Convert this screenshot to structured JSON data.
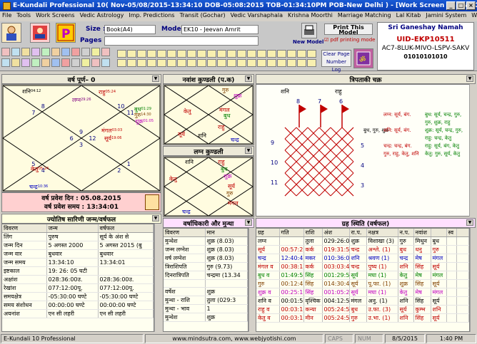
{
  "window": {
    "title": "E-Kundali Professional 10( Nov-05/08/2015-13:34:10 DOB-05:08:2015 TOB-01:34:10PM POB-New Delhi )  - [Work Screen Annual Chart]"
  },
  "menu": [
    "File",
    "Tools",
    "Work Screens",
    "Vedic Astrology",
    "Imp. Predictions",
    "Transit (Gochar)",
    "Vedic Varshaphala",
    "Krishna Moorthi",
    "Marriage Matching",
    "Lal Kitab",
    "Jamini System",
    "Window"
  ],
  "toolbar": {
    "size_label": "Size :",
    "size_value": "Book(A4)",
    "model_label": "Model :",
    "model_value": "EK10 - Jeevan Amrit",
    "pages_label": "Pages :",
    "new_model": "New Model",
    "print_model": "Print This Model",
    "pdf_printing": "pdf printing mode",
    "clear_page": "Clear Page",
    "number_log": "Number Log",
    "greeting": "Sri Ganeshay Namah",
    "uid": "UID-EKP10511",
    "code": "AC7-8LUK-MIVO-LSPV-SAKV",
    "serial": "01010101010"
  },
  "varsh": {
    "title": "वर्ष पूर्ण– 0",
    "pravesh_din": "वर्ष प्रवेश दिन : 05.08.2015",
    "pravesh_samay": "वर्ष प्रवेश समय : 13:34:01",
    "houses": [
      "9",
      "8",
      "7",
      "6",
      "5",
      "4",
      "3",
      "2",
      "1",
      "12",
      "11",
      "10"
    ],
    "planets": [
      {
        "t": "शनि",
        "d": "04:12",
        "c": "#000"
      },
      {
        "t": "राहु",
        "d": "05:24",
        "c": "#c00000"
      },
      {
        "t": "लग्न",
        "d": "29:26",
        "c": "#800080"
      },
      {
        "t": "बुध",
        "d": "01:29",
        "c": "#008000"
      },
      {
        "t": "गुरु",
        "d": "14:30",
        "c": "#804000"
      },
      {
        "t": "शुक्र",
        "d": "01:05",
        "c": "#c000c0"
      },
      {
        "t": "मंगल",
        "d": "03:03",
        "c": "#c00000"
      },
      {
        "t": "सूर्य",
        "d": "19:06",
        "c": "#c00000"
      },
      {
        "t": "केतु",
        "d": "05:24",
        "c": "#c00000"
      },
      {
        "t": "चन्द्र",
        "d": "10:36",
        "c": "#0000c0"
      }
    ]
  },
  "navamsha": {
    "title": "नवांश कुण्डली (प.क)",
    "planets": [
      "गुरु",
      "शुक्र",
      "केतु",
      "मंगल",
      "बुध",
      "राहु",
      "सूर्य",
      "शनि",
      "चन्द्र"
    ]
  },
  "lagna": {
    "title": "लग्न कुण्डली",
    "planets": [
      "शनि",
      "राहु",
      "बुध",
      "शुक्र",
      "केतु",
      "सूर्य",
      "गुरु",
      "मंगल",
      "चन्द्र"
    ]
  },
  "tripataki": {
    "title": "त्रिपताकी चक्र",
    "top": [
      "शनि",
      "राहु"
    ],
    "left": [
      "9",
      "10",
      "11"
    ],
    "right": [
      "3",
      "4",
      "5"
    ],
    "topnums": [
      "8",
      "7",
      "6"
    ],
    "mid": [
      "बुध, गुरु, शुक्र"
    ],
    "lines": [
      [
        "लग्न: सूर्य, बंग.",
        "बुध: सूर्य, चन्द्र, गुरु,"
      ],
      [
        "",
        "गुरु, शुक्र, राहु"
      ],
      [
        "शनि: सूर्य, बंग.",
        "शुक्र: सूर्य, चन्द्र, गुरु,"
      ],
      [
        "",
        "राहु: चन्द्र, केतु"
      ],
      [
        "चन्द्र: चन्द्र, बंग.",
        "राहु: सूर्य, बंग, केतु"
      ],
      [
        "गुरु, राहु, केतु, शनि",
        "केतु: गुरु, सूर्य, केतु"
      ]
    ]
  },
  "jyotish": {
    "title": "ज्योतिष सारिणी जन्म/वर्षफल",
    "cols": [
      "विवरण",
      "जन्म",
      "वर्षफल"
    ],
    "rows": [
      [
        "लिंग",
        "पुरुष",
        "सूर्य के अंश से"
      ],
      [
        "जन्म दिन",
        "5 अगस्त 2000",
        "5 अगस्त 2015 (बु"
      ],
      [
        "जन्म वार",
        "बुधवार",
        "बुधवार"
      ],
      [
        "जन्म समय",
        "13:34:10",
        "13:34:01"
      ],
      [
        "इष्टकाल",
        "19: 26: 05 घटी",
        ""
      ],
      [
        "अक्षांश",
        "028:36:00उ.",
        "028:36:00उ."
      ],
      [
        "रेखांश",
        "077:12:00पू.",
        "077:12:00पू."
      ],
      [
        "समयक्षेत्र",
        "-05:30:00 घण्टे",
        "-05:30:00 घण्टे"
      ],
      [
        "समय संशोधन",
        "00:00:00 घण्टे",
        "00:00:00 घण्टे"
      ],
      [
        "अयनांश",
        "एन सी लहरी",
        "एन सी लहरी"
      ]
    ]
  },
  "varshadhikari": {
    "title": "वर्षाधिकारी और मुन्था",
    "cols": [
      "विवरण",
      "मान"
    ],
    "rows": [
      [
        "मुन्थेश",
        "शुक्र (8.03)"
      ],
      [
        "जन्म लग्नेश",
        "शुक्र (8.03)"
      ],
      [
        "वर्ष लग्नेश",
        "शुक्र (8.03)"
      ],
      [
        "त्रिराशिपति",
        "गुरु (9.73)"
      ],
      [
        "दिनरात्रिपति",
        "चन्द्रमा (13.34"
      ],
      [
        "",
        ""
      ],
      [
        "वर्षेश",
        "शुक्र"
      ],
      [
        "मुन्था - राशि",
        "तुला  (029:3"
      ],
      [
        "मुन्था - भाव",
        "1"
      ],
      [
        "मुन्थेश",
        "शुक्र"
      ]
    ]
  },
  "grah": {
    "title": "ग्रह स्थिति (वर्षफल)",
    "cols": [
      "ग्रह",
      "गति",
      "राशि",
      "अंश",
      "रा.प.",
      "नक्षत्र",
      "न.प.",
      "नवांश",
      "",
      "स्व"
    ],
    "rows": [
      [
        "लग्न",
        "",
        "तुला",
        "029:26:06",
        "शुक्र",
        "विशाखा (3)",
        "गुरु",
        "मिथुन",
        "बुध",
        "",
        ""
      ],
      [
        "सूर्य",
        "00:57:27",
        "कर्क",
        "019:31:54",
        "चन्द्र",
        "अश्ले. (1)",
        "बुध",
        "धनु",
        "गुरु",
        "",
        ""
      ],
      [
        "चन्द्र",
        "12:40:42",
        "मकर",
        "010:36:03",
        "शनि",
        "श्रवण (1)",
        "चन्द्र",
        "मेष",
        "मंगल",
        "",
        ""
      ],
      [
        "मंगल व",
        "00:38:18",
        "कर्क",
        "003:03:41",
        "चन्द्र",
        "पुष्य (1)",
        "शनि",
        "सिंह",
        "सूर्य",
        "",
        ""
      ],
      [
        "बुध व",
        "01:49:58",
        "सिंह",
        "001:29:50",
        "सूर्य",
        "मघा (1)",
        "केतु",
        "मेष",
        "मंगल",
        "",
        ""
      ],
      [
        "गुरु",
        "00:12:47",
        "सिंह",
        "014:30:41",
        "सूर्य",
        "पू.फा. (1)",
        "शुक्र",
        "सिंह",
        "सूर्य",
        "",
        ""
      ],
      [
        "शुक्र व",
        "00:25:19",
        "सिंह",
        "001:05:24",
        "सूर्य",
        "मघा (1)",
        "केतु",
        "मेष",
        "मंगल",
        "",
        ""
      ],
      [
        "शनि व",
        "00:01:57",
        "वृश्चिक",
        "004:12:55",
        "मंगल",
        "अनु. (1)",
        "शनि",
        "सिंह",
        "सूर्य",
        "",
        ""
      ],
      [
        "राहु व",
        "00:03:10",
        "कन्या",
        "005:24:55",
        "बुध",
        "उ.फा. (3)",
        "सूर्य",
        "कुम्भ",
        "शनि",
        "",
        ""
      ],
      [
        "केतु व",
        "00:03:10",
        "मीन",
        "005:24:55",
        "गुरु",
        "उ.भा. (1)",
        "शनि",
        "सिंह",
        "सूर्य",
        "",
        ""
      ]
    ],
    "rowcolors": [
      "#000",
      "#c00000",
      "#0000c0",
      "#c00000",
      "#008000",
      "#804000",
      "#c000c0",
      "#000",
      "#c00000",
      "#c00000"
    ]
  },
  "status": {
    "app": "E-Kundali 10 Professional",
    "url": "www.mindsutra.com, www.webjyotishi.com",
    "caps": "CAPS",
    "num": "NUM",
    "date": "8/5/2015",
    "time": "1:40 PM"
  }
}
